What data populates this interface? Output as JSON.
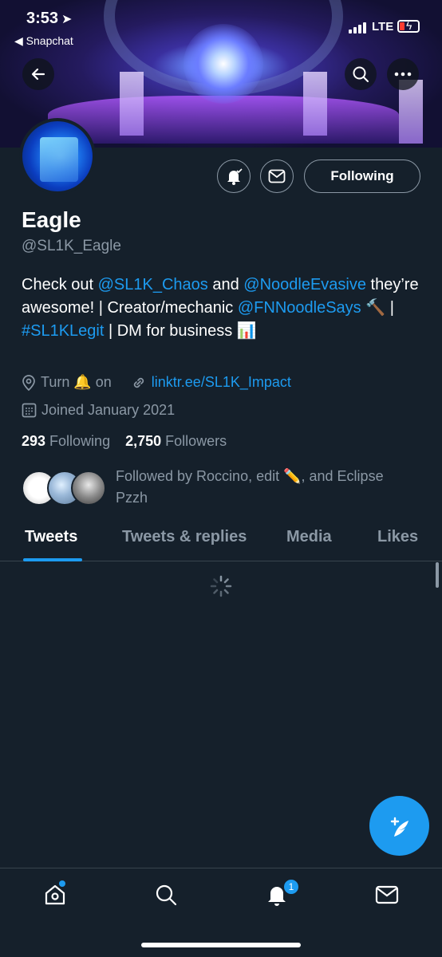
{
  "status_bar": {
    "time": "3:53",
    "back_app": "◀ Snapchat",
    "network": "LTE"
  },
  "profile": {
    "name": "Eagle",
    "handle": "@SL1K_Eagle",
    "following_button": "Following",
    "bio": {
      "part1": "Check out ",
      "mention1": "@SL1K_Chaos",
      "part2": " and ",
      "mention2": "@NoodleEvasive",
      "part3": " they’re awesome! | Creator/mechanic ",
      "mention3": "@FNNoodleSays",
      "part4": " 🔨 | ",
      "hashtag": "#SL1KLegit",
      "part5": " | DM for business 📊"
    },
    "location": "Turn 🔔 on",
    "website": "linktr.ee/SL1K_Impact",
    "joined": "Joined January 2021",
    "following_count": "293",
    "following_label": " Following",
    "followers_count": "2,750",
    "followers_label": " Followers",
    "followed_by": "Followed by Roccino, edit ✏️, and Eclipse Pzzh"
  },
  "tabs": [
    {
      "label": "Tweets"
    },
    {
      "label": "Tweets & replies"
    },
    {
      "label": "Media"
    },
    {
      "label": "Likes"
    }
  ],
  "bottom_nav": {
    "notifications_badge": "1"
  },
  "colors": {
    "background": "#15202b",
    "accent": "#1d9bf0",
    "secondary_text": "#8b98a5"
  }
}
